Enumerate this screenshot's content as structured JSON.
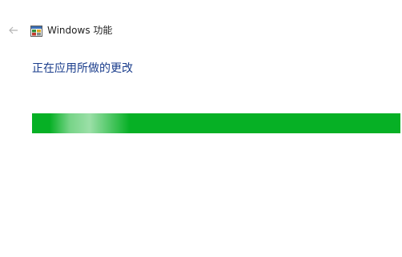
{
  "window": {
    "title": "Windows 功能",
    "back_icon": "arrow-left-icon",
    "app_icon": "windows-features-icon"
  },
  "status": {
    "heading": "正在应用所做的更改"
  },
  "progress": {
    "value": 1.0,
    "color": "#06b025"
  },
  "colors": {
    "heading": "#1a3d8c",
    "back_arrow": "#b4b4b4",
    "progress_fill": "#06b025"
  }
}
